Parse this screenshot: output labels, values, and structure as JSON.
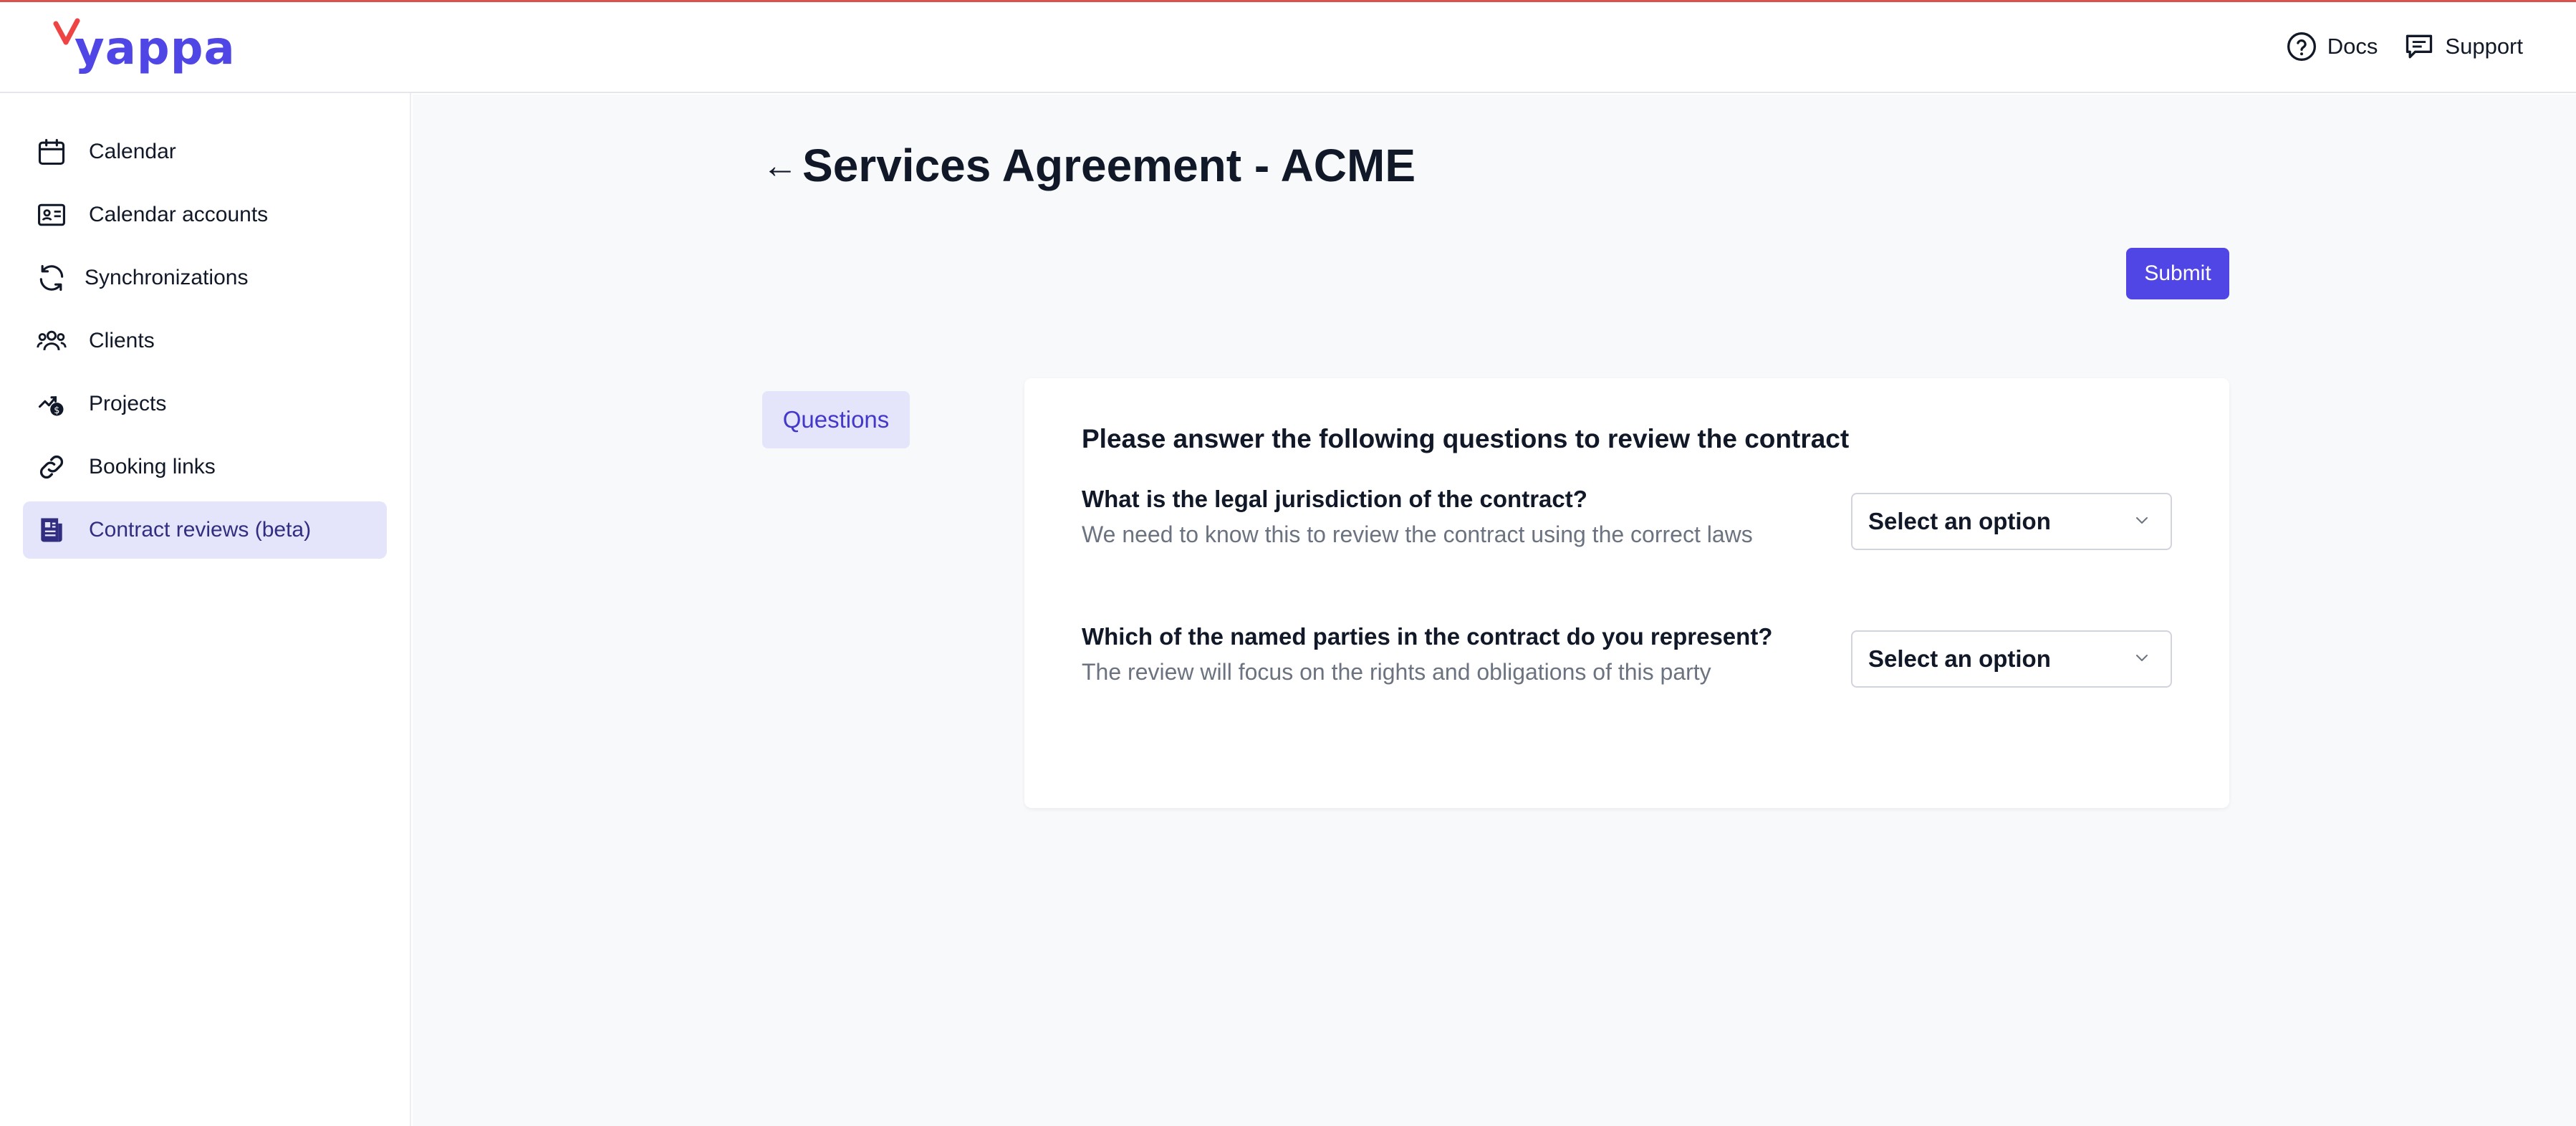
{
  "app": {
    "logo_text": "yappa"
  },
  "header": {
    "links": [
      {
        "label": "Docs",
        "icon": "question-circle-icon"
      },
      {
        "label": "Support",
        "icon": "chat-icon"
      }
    ]
  },
  "sidebar": {
    "items": [
      {
        "label": "Calendar",
        "icon": "calendar-icon",
        "active": false
      },
      {
        "label": "Calendar accounts",
        "icon": "id-card-icon",
        "active": false
      },
      {
        "label": "Synchronizations",
        "icon": "sync-icon",
        "active": false
      },
      {
        "label": "Clients",
        "icon": "users-icon",
        "active": false
      },
      {
        "label": "Projects",
        "icon": "projects-icon",
        "active": false
      },
      {
        "label": "Booking links",
        "icon": "link-icon",
        "active": false
      },
      {
        "label": "Contract reviews (beta)",
        "icon": "document-icon",
        "active": true
      }
    ]
  },
  "page": {
    "back_arrow": "←",
    "title": "Services Agreement - ACME",
    "submit_label": "Submit",
    "tab_label": "Questions"
  },
  "form": {
    "heading": "Please answer the following questions to review the contract",
    "questions": [
      {
        "label": "What is the legal jurisdiction of the contract?",
        "help": "We need to know this to review the contract using the correct laws",
        "selected": "Select an option"
      },
      {
        "label": "Which of the named parties in the contract do you represent?",
        "help": "The review will focus on the rights and obligations of this party",
        "selected": "Select an option"
      }
    ]
  },
  "colors": {
    "accent": "#4f46e5",
    "active_bg": "#e4e5fb",
    "top_border": "#d9534f",
    "main_bg": "#f8f9fb"
  }
}
